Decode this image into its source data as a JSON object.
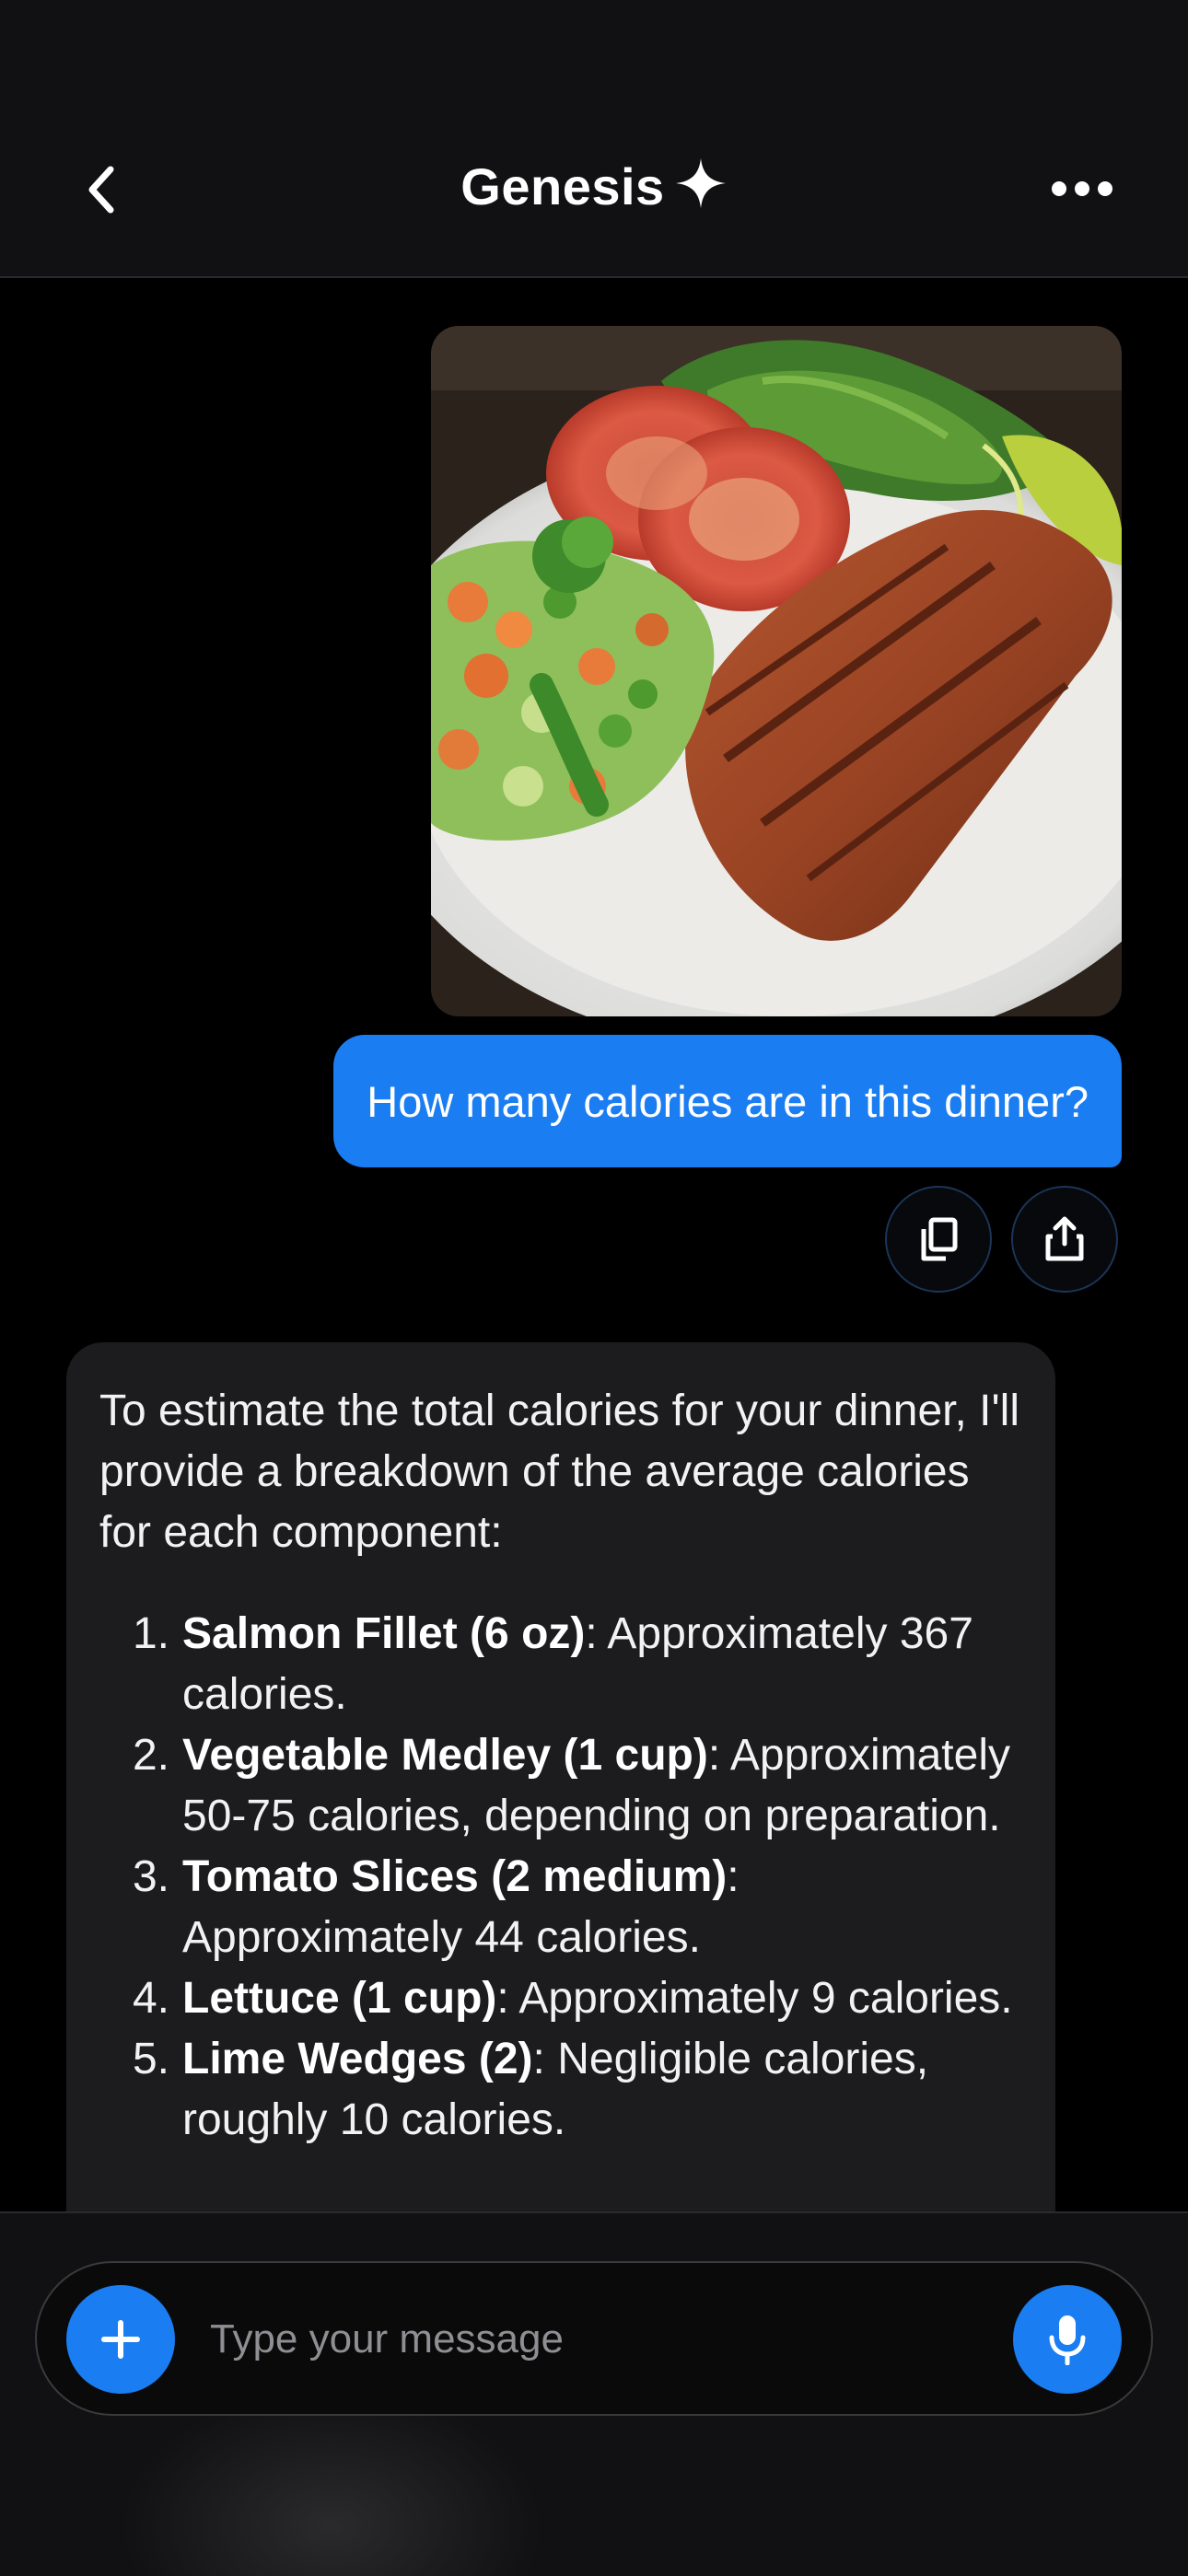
{
  "header": {
    "title": "Genesis",
    "title_icon": "sparkle-icon",
    "back_icon": "chevron-left-icon",
    "more_icon": "more-horizontal-icon"
  },
  "conversation": {
    "user_image": {
      "subject": "plate of grilled salmon with tomato slices, lettuce, lime wedges and mixed vegetables",
      "icon": "photo"
    },
    "user_message": "How many calories are in this dinner?",
    "message_actions": [
      {
        "icon": "copy-icon"
      },
      {
        "icon": "share-icon"
      }
    ],
    "assistant_message": {
      "intro": "To estimate the total calories for your dinner, I'll provide a breakdown of the average calories for each component:",
      "items": [
        {
          "num": "1.",
          "name": "Salmon Fillet (6 oz)",
          "detail": ": Approximately 367 calories."
        },
        {
          "num": "2.",
          "name": "Vegetable Medley (1 cup)",
          "detail": ": Approximately 50-75 calories, depending on preparation."
        },
        {
          "num": "3.",
          "name": "Tomato Slices (2 medium)",
          "detail": ": Approximately 44 calories."
        },
        {
          "num": "4.",
          "name": "Lettuce (1 cup)",
          "detail": ": Approximately 9 calories."
        },
        {
          "num": "5.",
          "name": "Lime Wedges (2)",
          "detail": ": Negligible calories, roughly 10 calories."
        }
      ]
    }
  },
  "composer": {
    "placeholder": "Type your message",
    "add_icon": "plus-icon",
    "mic_icon": "microphone-icon"
  },
  "colors": {
    "accent": "#1a7df2",
    "background": "#000000",
    "header_bg": "#111113",
    "assistant_bubble": "#1c1c1e"
  }
}
